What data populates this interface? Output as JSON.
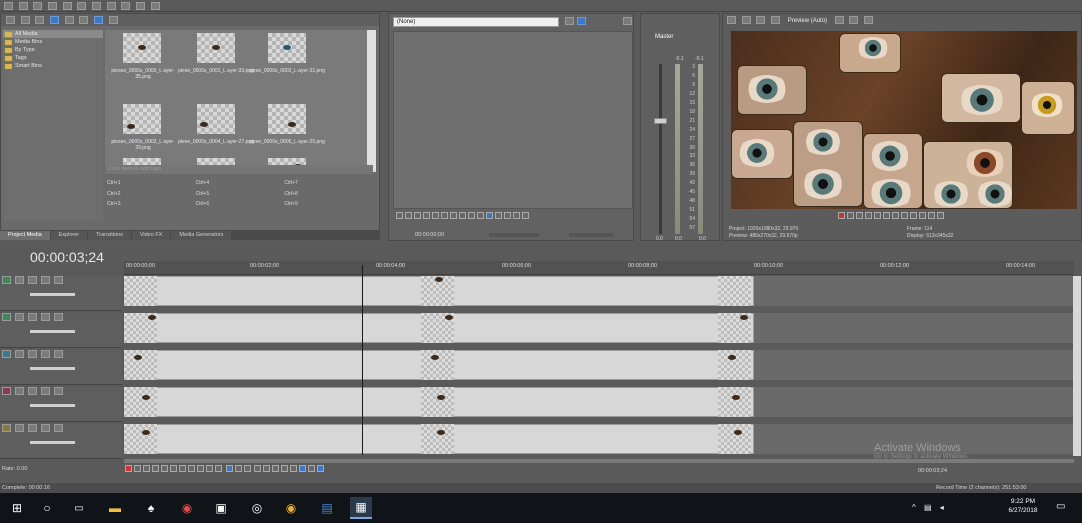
{
  "project_media": {
    "tree": [
      "All Media",
      "Media Bins",
      "By Type",
      "Tags",
      "Smart Bins"
    ],
    "thumbs": [
      {
        "label": "pieseo_0000s_0000_L ayer-35.png"
      },
      {
        "label": "piese_0000s_0001_L ayer-33.png"
      },
      {
        "label": "piese_0000s_0002_L ayer-31.png"
      },
      {
        "label": "pieseo_0000s_0003_L ayer-29.png"
      },
      {
        "label": "piese_0000s_0004_L ayer-27.png"
      },
      {
        "label": "piese_0000s_0005_L ayer-25.png"
      }
    ],
    "tags_placeholder": "Click here to add tags",
    "ctrl_shortcuts": [
      "Ctrl+1",
      "Ctrl+4",
      "Ctrl+7",
      "Ctrl+2",
      "Ctrl+5",
      "Ctrl+8",
      "Ctrl+3",
      "Ctrl+6",
      "Ctrl+9"
    ]
  },
  "bottom_tabs": [
    "Project Media",
    "Explorer",
    "Transitions",
    "Video FX",
    "Media Generators"
  ],
  "trimmer": {
    "select_value": "(None)",
    "time": "00:00:00;00"
  },
  "master": {
    "label": "Master",
    "levels": [
      "-0.1",
      "-0.1"
    ],
    "scale": [
      "3",
      "6",
      "9",
      "12",
      "15",
      "18",
      "21",
      "24",
      "27",
      "30",
      "33",
      "36",
      "39",
      "42",
      "45",
      "48",
      "51",
      "54",
      "57"
    ],
    "bottom": [
      "0.0",
      "0.0",
      "0.0"
    ]
  },
  "preview": {
    "mode": "Preview (Auto)",
    "project_label": "Project:",
    "project_value": "1920x1080x32, 29.970",
    "preview_label": "Preview:",
    "preview_value": "480x270x32, 29.970p",
    "frame_label": "Frame:",
    "frame_value": "114",
    "display_label": "Display:",
    "display_value": "613x345x32"
  },
  "timeline": {
    "timecode": "00:00:03;24",
    "ruler": [
      "00:00:00;00",
      "00:00:02;00",
      "00:00:04;00",
      "00:00:06;00",
      "00:00:08;00",
      "00:00:10;00",
      "00:00:12;00",
      "00:00:14;00"
    ],
    "rate": "Rate: 0.00",
    "end_time": "00:00:03;24",
    "watermark_title": "Activate Windows",
    "watermark_sub": "Go to Settings to activate Windows."
  },
  "status": {
    "complete": "Complete: 00:00:16",
    "record_time": "Record Time (2 channels): 251:53:00"
  },
  "taskbar": {
    "time": "9:22 PM",
    "date": "6/27/2018"
  },
  "colors": {
    "accent": "#3e78c4",
    "panel": "#6b6b6b",
    "taskbar": "#101418"
  }
}
